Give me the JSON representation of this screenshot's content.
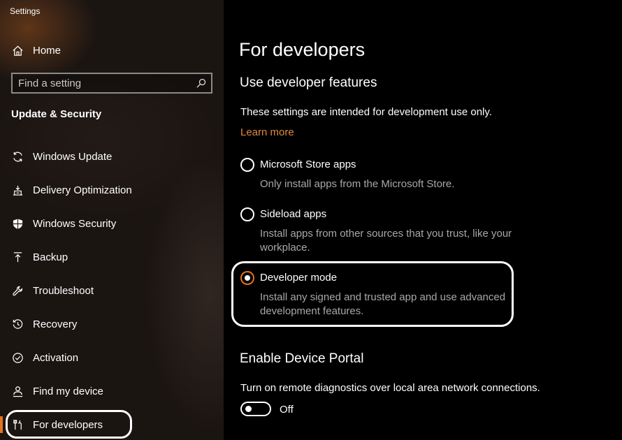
{
  "window": {
    "title": "Settings"
  },
  "sidebar": {
    "home_label": "Home",
    "search": {
      "placeholder": "Find a setting",
      "value": ""
    },
    "section_title": "Update & Security",
    "items": [
      {
        "label": "Windows Update",
        "icon": "sync-icon"
      },
      {
        "label": "Delivery Optimization",
        "icon": "delivery-optimization-icon"
      },
      {
        "label": "Windows Security",
        "icon": "shield-icon"
      },
      {
        "label": "Backup",
        "icon": "upload-arrow-icon"
      },
      {
        "label": "Troubleshoot",
        "icon": "wrench-icon"
      },
      {
        "label": "Recovery",
        "icon": "recovery-icon"
      },
      {
        "label": "Activation",
        "icon": "check-circle-icon"
      },
      {
        "label": "Find my device",
        "icon": "person-location-icon"
      },
      {
        "label": "For developers",
        "icon": "developer-tools-icon",
        "selected": true
      }
    ],
    "accent_color": "#e2721f"
  },
  "main": {
    "page_title": "For developers",
    "dev_features": {
      "heading": "Use developer features",
      "intro": "These settings are intended for development use only.",
      "learn_more": "Learn more",
      "options": [
        {
          "label": "Microsoft Store apps",
          "description": "Only install apps from the Microsoft Store.",
          "checked": false
        },
        {
          "label": "Sideload apps",
          "description": "Install apps from other sources that you trust, like your workplace.",
          "checked": false
        },
        {
          "label": "Developer mode",
          "description": "Install any signed and trusted app and use advanced development features.",
          "checked": true
        }
      ]
    },
    "device_portal": {
      "heading": "Enable Device Portal",
      "description": "Turn on remote diagnostics over local area network connections.",
      "toggle_state": "Off"
    },
    "link_color": "#e2873a"
  }
}
